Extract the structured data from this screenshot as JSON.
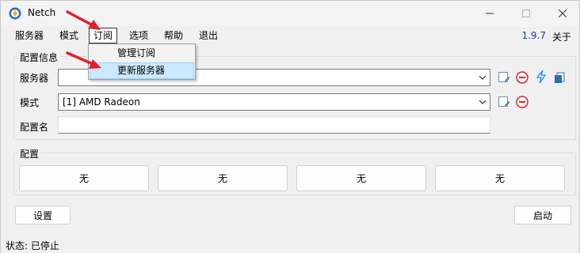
{
  "window": {
    "title": "Netch"
  },
  "menu": {
    "items": [
      "服务器",
      "模式",
      "订阅",
      "选项",
      "帮助",
      "退出"
    ],
    "version": "1.9.7",
    "about": "关于"
  },
  "subscription_menu": {
    "items": [
      "管理订阅",
      "更新服务器"
    ],
    "selected": "更新服务器"
  },
  "config_info": {
    "title": "配置信息",
    "server_label": "服务器",
    "server_value": "",
    "mode_label": "模式",
    "mode_value": "[1] AMD Radeon",
    "profile_label": "配置名",
    "profile_value": ""
  },
  "profiles": {
    "title": "配置",
    "buttons": [
      "无",
      "无",
      "无",
      "无"
    ]
  },
  "buttons": {
    "settings": "设置",
    "start": "启动"
  },
  "status": {
    "text": "状态: 已停止"
  },
  "colors": {
    "version": "#1a3ea8",
    "annotation_arrow": "#e0202a",
    "delete_icon": "#e0202a",
    "speed_icon": "#1e90ff"
  },
  "icons": [
    "netch-app-icon",
    "minimize-icon",
    "maximize-icon",
    "close-icon",
    "edit-icon",
    "delete-icon",
    "speedtest-icon",
    "copy-icon",
    "chevron-down-icon"
  ]
}
